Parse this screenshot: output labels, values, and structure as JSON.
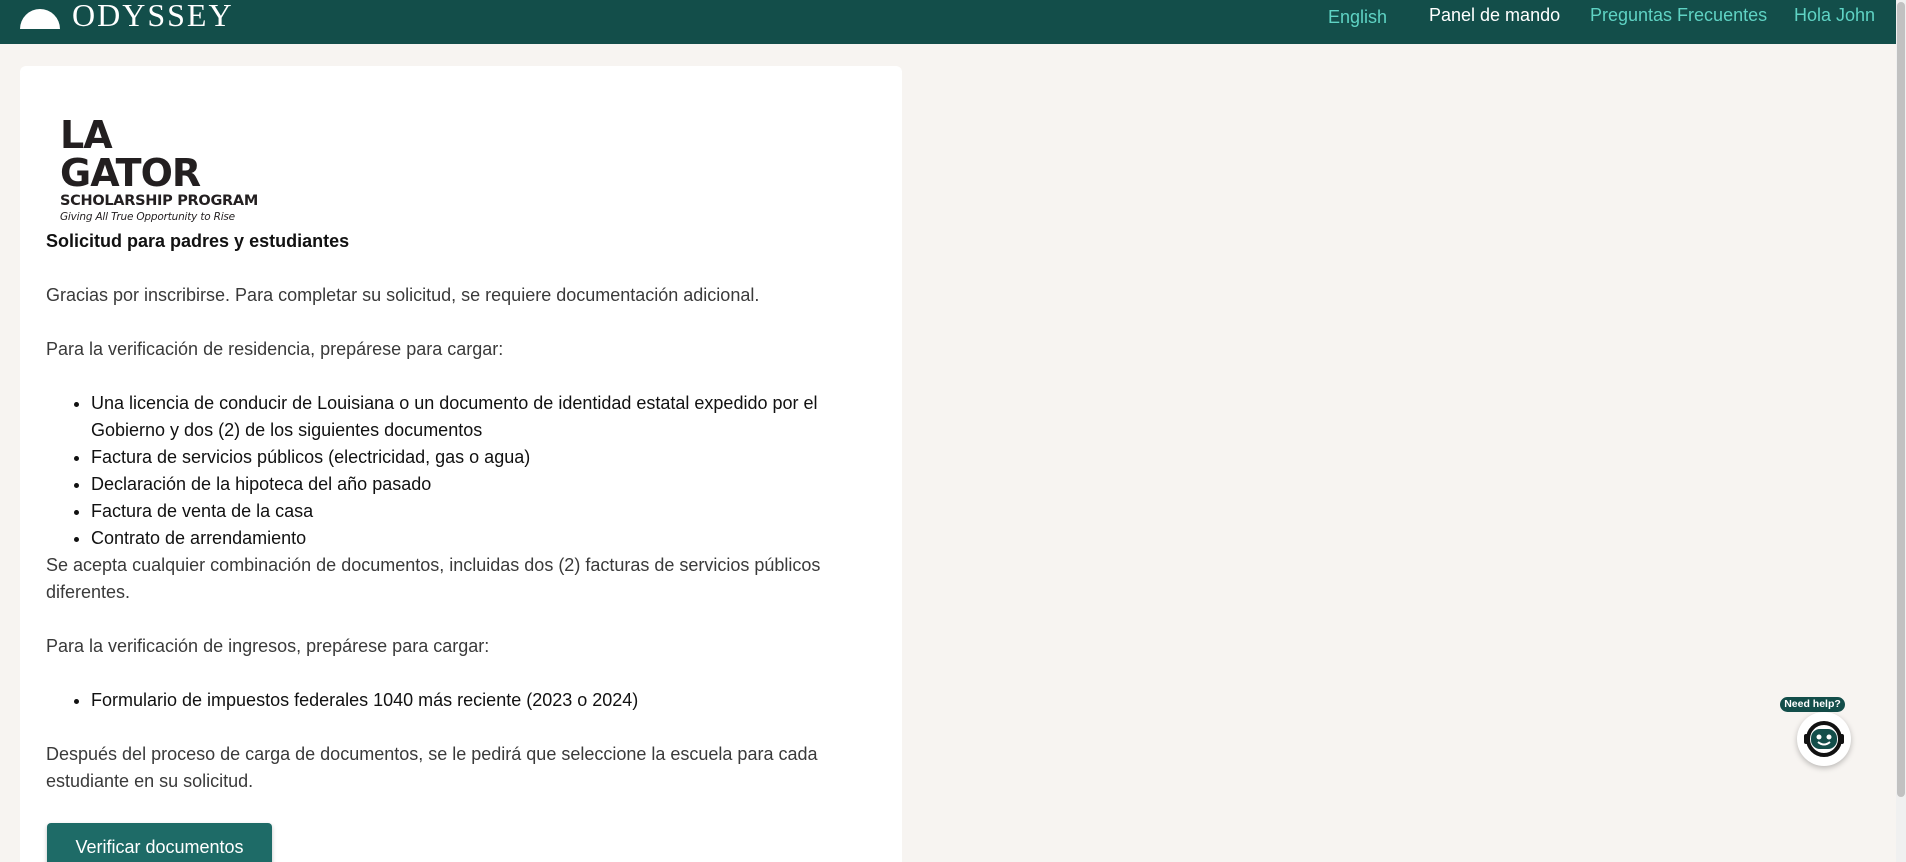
{
  "nav": {
    "brand": "ODYSSEY",
    "language": "English",
    "dashboard": "Panel de mando",
    "faq": "Preguntas Frecuentes",
    "user_greeting": "Hola John"
  },
  "logo": {
    "main": "LA GATOR",
    "sub": "SCHOLARSHIP PROGRAM",
    "tagline": "Giving All True Opportunity to Rise"
  },
  "content": {
    "heading": "Solicitud para padres y estudiantes",
    "intro": "Gracias por inscribirse. Para completar su solicitud, se requiere documentación adicional.",
    "residency_intro": "Para la verificación de residencia, prepárese para cargar:",
    "residency_items": [
      "Una licencia de conducir de Louisiana o un documento de identidad estatal expedido por el Gobierno y dos (2) de los siguientes documentos",
      "Factura de servicios públicos (electricidad, gas o agua)",
      "Declaración de la hipoteca del año pasado",
      "Factura de venta de la casa",
      "Contrato de arrendamiento"
    ],
    "residency_note": "Se acepta cualquier combinación de documentos, incluidas dos (2) facturas de servicios públicos diferentes.",
    "income_intro": "Para la verificación de ingresos, prepárese para cargar:",
    "income_items": [
      "Formulario de impuestos federales 1040 más reciente (2023 o 2024)"
    ],
    "closing": "Después del proceso de carga de documentos, se le pedirá que seleccione la escuela para cada estudiante en su solicitud.",
    "verify_button": "Verificar documentos"
  },
  "help": {
    "badge": "Need help?",
    "icon": "chat-bot-icon"
  },
  "colors": {
    "nav_bg": "#134e4a",
    "nav_link_accent": "#5fd3c4",
    "button_bg": "#1e6b67",
    "page_bg": "#f7f4f1"
  }
}
